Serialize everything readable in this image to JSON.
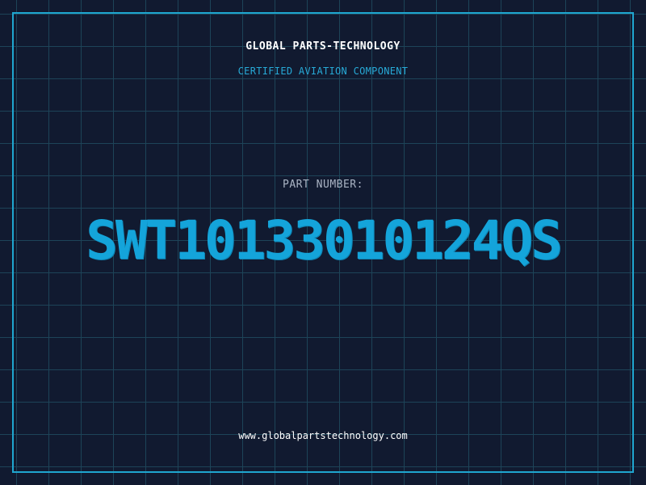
{
  "header": {
    "company": "GLOBAL PARTS-TECHNOLOGY",
    "subtitle": "CERTIFIED AVIATION COMPONENT"
  },
  "part": {
    "label": "PART NUMBER:",
    "number": "SWT10133010124QS"
  },
  "footer": {
    "website": "www.globalpartstechnology.com"
  },
  "colors": {
    "background": "#111a30",
    "grid": "#1d4458",
    "border": "#1fa6cf",
    "accent": "#14a4da"
  }
}
